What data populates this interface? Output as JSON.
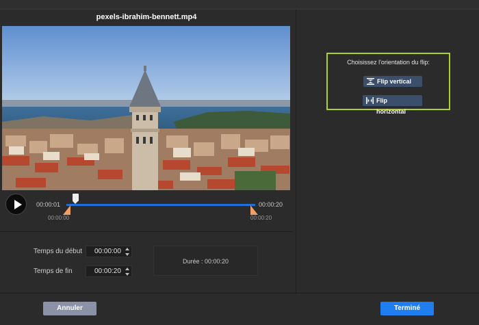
{
  "editor": {
    "file_name": "pexels-ibrahim-bennett.mp4"
  },
  "playback": {
    "current_time": "00:00:01",
    "total_time": "00:00:20",
    "trim_start_time": "00:00:00",
    "trim_end_time": "00:00:20",
    "progress_fraction": 0.05
  },
  "trim": {
    "start_label": "Temps du début",
    "start_value": "00:00:00",
    "end_label": "Temps de fin",
    "end_value": "00:00:20",
    "duration_text": "Durée : 00:00:20"
  },
  "flip": {
    "title": "Choisissez l'orientation du flip:",
    "vertical_label": "Flip vertical",
    "horizontal_label": "Flip horizontal"
  },
  "footer": {
    "cancel_label": "Annuler",
    "done_label": "Terminé"
  },
  "colors": {
    "accent_blue": "#1f7ef0",
    "trim_handle": "#f0a066",
    "highlight_border": "#a9d32d",
    "cancel_button": "#8b92a8"
  },
  "icons": {
    "play": "play-icon",
    "flip_vertical": "flip-vertical-icon",
    "flip_horizontal": "flip-horizontal-icon"
  }
}
